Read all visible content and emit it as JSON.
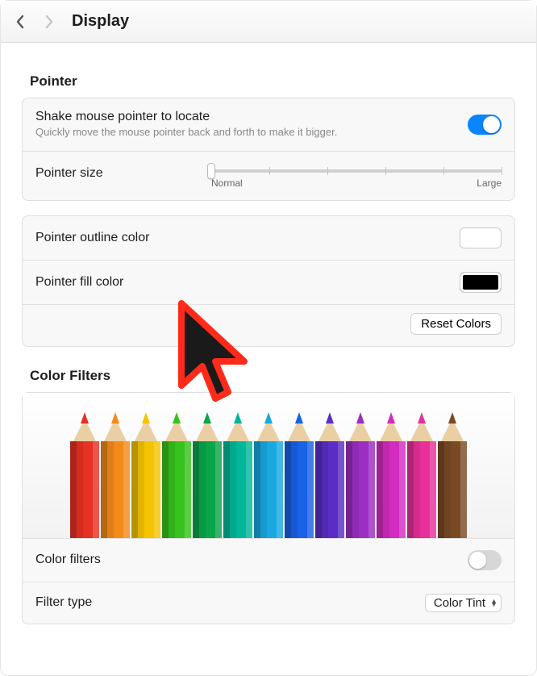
{
  "header": {
    "title": "Display"
  },
  "pointer": {
    "section_label": "Pointer",
    "shake": {
      "label": "Shake mouse pointer to locate",
      "sub": "Quickly move the mouse pointer back and forth to make it bigger.",
      "on": true
    },
    "size": {
      "label": "Pointer size",
      "min_label": "Normal",
      "max_label": "Large",
      "value_pct": 0
    },
    "outline": {
      "label": "Pointer outline color",
      "color": "#ffffff"
    },
    "fill": {
      "label": "Pointer fill color",
      "color": "#000000"
    },
    "reset_label": "Reset Colors"
  },
  "filters": {
    "section_label": "Color Filters",
    "pencil_colors": [
      "#e63123",
      "#f28a1a",
      "#f5c400",
      "#37c21d",
      "#0aa54a",
      "#00b79a",
      "#1aa8e0",
      "#1961e6",
      "#5a2ec4",
      "#9c2ec4",
      "#d22cc1",
      "#e8309b",
      "#7a4a25"
    ],
    "toggle": {
      "label": "Color filters",
      "on": false
    },
    "type": {
      "label": "Filter type",
      "value": "Color Tint"
    }
  }
}
